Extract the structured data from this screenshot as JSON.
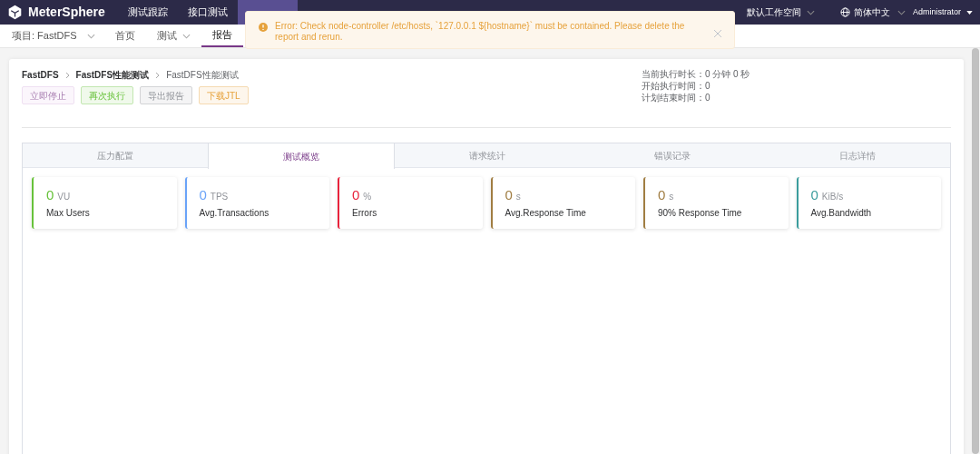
{
  "header": {
    "logo": "MeterSphere",
    "nav": [
      {
        "label": "测试跟踪",
        "selected": false
      },
      {
        "label": "接口测试",
        "selected": false
      },
      {
        "selected": true
      },
      {
        "selected": false
      }
    ],
    "workspace_value": "默认工作空间",
    "language": "简体中文",
    "user": "Administrator"
  },
  "subnav": {
    "project": "项目: FastDFS",
    "items": [
      {
        "label": "首页",
        "selected": false,
        "dropdown": false
      },
      {
        "label": "测试",
        "selected": false,
        "dropdown": true
      },
      {
        "label": "报告",
        "selected": true,
        "dropdown": false
      }
    ]
  },
  "notification": {
    "message": "Error: Check node-controller /etc/hosts, `127.0.0.1 ${hostname}` must be contained. Please delete the report and rerun."
  },
  "breadcrumb": [
    {
      "label": "FastDFS",
      "bold": true
    },
    {
      "label": "FastDFS性能测试",
      "bold": true
    },
    {
      "label": "FastDFS性能测试",
      "bold": false
    }
  ],
  "actions": [
    {
      "label": "立即停止",
      "kind": "stop",
      "disabled": true
    },
    {
      "label": "再次执行",
      "kind": "success",
      "disabled": false
    },
    {
      "label": "导出报告",
      "kind": "info",
      "disabled": false
    },
    {
      "label": "下载JTL",
      "kind": "warning",
      "disabled": false
    }
  ],
  "run_info": [
    "当前执行时长：0 分钟 0 秒",
    "开始执行时间：0",
    "计划结束时间：0"
  ],
  "tabs": [
    {
      "label": "压力配置",
      "selected": false
    },
    {
      "label": "测试概览",
      "selected": true
    },
    {
      "label": "请求统计",
      "selected": false
    },
    {
      "label": "错误记录",
      "selected": false
    },
    {
      "label": "日志详情",
      "selected": false
    }
  ],
  "metrics": [
    {
      "value": "0",
      "unit": "VU",
      "label": "Max Users",
      "color": "#67c23a"
    },
    {
      "value": "0",
      "unit": "TPS",
      "label": "Avg.Transactions",
      "color": "#6aa3f8"
    },
    {
      "value": "0",
      "unit": "%",
      "label": "Errors",
      "color": "#e8233c"
    },
    {
      "value": "0",
      "unit": "s",
      "label": "Avg.Response Time",
      "color": "#a07d42"
    },
    {
      "value": "0",
      "unit": "s",
      "label": "90% Response Time",
      "color": "#a07d42"
    },
    {
      "value": "0",
      "unit": "KiB/s",
      "label": "Avg.Bandwidth",
      "color": "#3a9c9c"
    }
  ]
}
